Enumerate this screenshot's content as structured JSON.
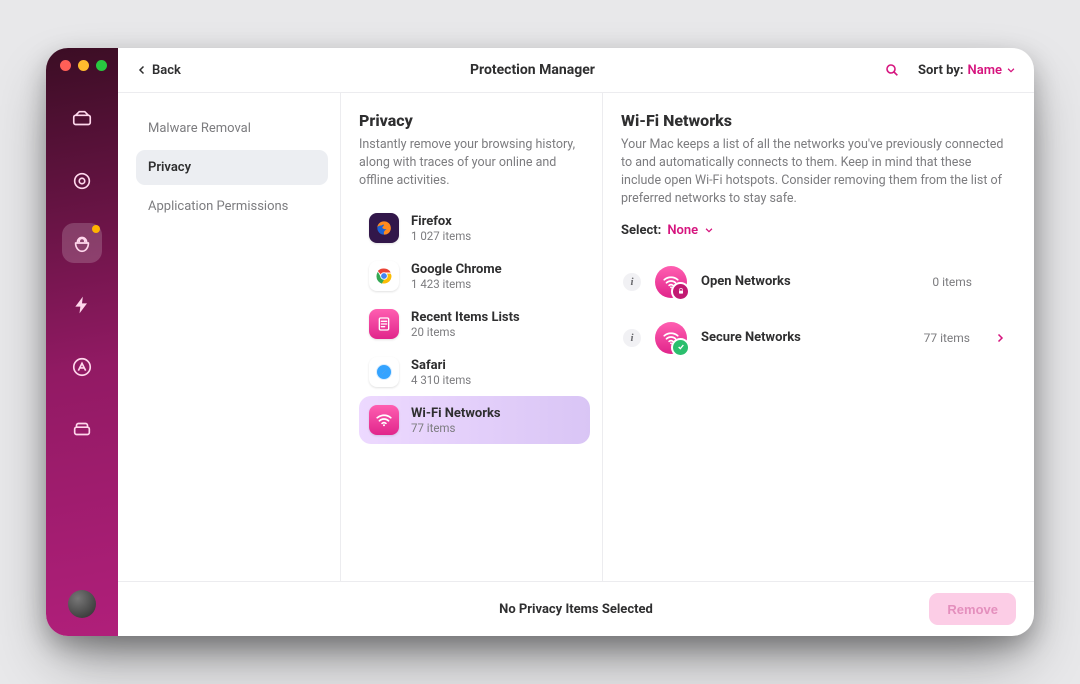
{
  "topbar": {
    "back": "Back",
    "title": "Protection Manager",
    "sort_label": "Sort by:",
    "sort_value": "Name"
  },
  "sidebar": {
    "items": [
      {
        "label": "Malware Removal"
      },
      {
        "label": "Privacy"
      },
      {
        "label": "Application Permissions"
      }
    ],
    "selected_index": 1
  },
  "privacy": {
    "heading": "Privacy",
    "desc": "Instantly remove your browsing history, along with traces of your online and offline activities.",
    "apps": [
      {
        "name": "Firefox",
        "sub": "1 027 items",
        "icon": "firefox"
      },
      {
        "name": "Google Chrome",
        "sub": "1 423 items",
        "icon": "chrome"
      },
      {
        "name": "Recent Items Lists",
        "sub": "20 items",
        "icon": "recent"
      },
      {
        "name": "Safari",
        "sub": "4 310 items",
        "icon": "safari"
      },
      {
        "name": "Wi-Fi Networks",
        "sub": "77 items",
        "icon": "wifi"
      }
    ],
    "selected_index": 4
  },
  "detail": {
    "heading": "Wi-Fi Networks",
    "desc": "Your Mac keeps a list of all the networks you've previously connected to and automatically connects to them. Keep in mind that these include open Wi-Fi hotspots. Consider removing them from the list of preferred networks to stay safe.",
    "select_label": "Select:",
    "select_value": "None",
    "rows": [
      {
        "name": "Open Networks",
        "count": "0 items",
        "kind": "open",
        "expandable": false
      },
      {
        "name": "Secure Networks",
        "count": "77 items",
        "kind": "secure",
        "expandable": true
      }
    ]
  },
  "footer": {
    "status": "No Privacy Items Selected",
    "remove": "Remove"
  },
  "rail": {
    "items": [
      "dashboard",
      "scan",
      "privacy",
      "speed",
      "uninstaller",
      "files"
    ],
    "active_index": 2,
    "badge_index": 2
  },
  "colors": {
    "accent": "#d6147e"
  }
}
